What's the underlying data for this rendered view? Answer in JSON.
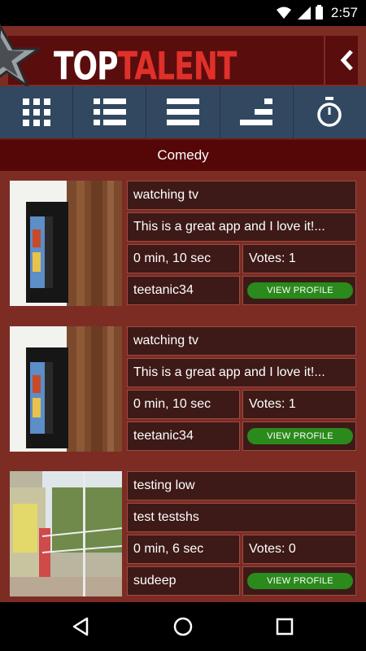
{
  "status_bar": {
    "time": "2:57",
    "icons": [
      "wifi-icon",
      "signal-icon",
      "battery-icon"
    ]
  },
  "header": {
    "logo_top": "TOP",
    "logo_talent": "TALENT",
    "back_icon": "chevron-left-icon"
  },
  "tabs": [
    {
      "icon": "grid-icon"
    },
    {
      "icon": "list-icon"
    },
    {
      "icon": "rows-icon"
    },
    {
      "icon": "ranking-icon"
    },
    {
      "icon": "stopwatch-icon"
    }
  ],
  "category": "Comedy",
  "cards": [
    {
      "title": "watching tv",
      "description": "This is a great app and I love it!...",
      "duration": "0 min, 10 sec",
      "votes": "Votes: 1",
      "username": "teetanic34",
      "button_label": "VIEW PROFILE"
    },
    {
      "title": "watching tv",
      "description": "This is a great app and I love it!...",
      "duration": "0 min, 10 sec",
      "votes": "Votes: 1",
      "username": "teetanic34",
      "button_label": "VIEW PROFILE"
    },
    {
      "title": "testing low",
      "description": "test testshs",
      "duration": "0 min, 6 sec",
      "votes": "Votes: 0",
      "username": "sudeep",
      "button_label": "VIEW PROFILE"
    }
  ],
  "nav": [
    "back-icon",
    "home-icon",
    "recents-icon"
  ],
  "colors": {
    "brand_red": "#e0302a",
    "header_bg": "#5a0d0d",
    "tab_bg": "#314860",
    "button_green": "#2a8a1c"
  }
}
